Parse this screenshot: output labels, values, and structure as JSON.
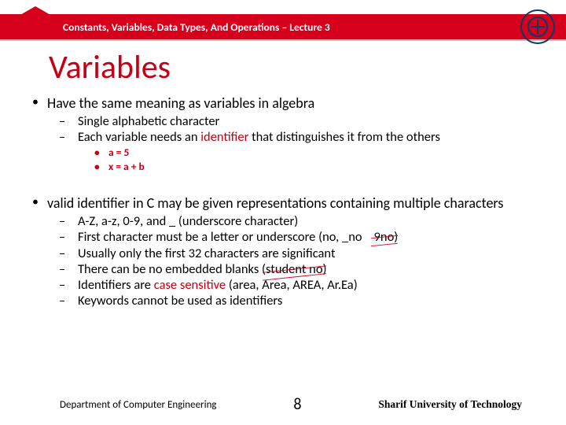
{
  "header": {
    "course_line": "Constants, Variables, Data Types, And Operations – Lecture 3"
  },
  "title": "Variables",
  "main": {
    "point1": {
      "text": "Have the same meaning as variables in algebra",
      "sub": [
        "Single alphabetic character",
        {
          "pre": "Each variable needs an ",
          "hi": "identifier",
          "post": " that distinguishes it from the others"
        }
      ],
      "code": [
        "a = 5",
        "x = a + b"
      ]
    },
    "point2": {
      "text": "valid identifier in C may be given representations containing multiple characters",
      "sub": [
        "A-Z, a-z, 0-9, and _ (underscore character)",
        {
          "pre": "First character must be a letter or underscore (no, _no",
          "strike": "9no",
          "post": ")"
        },
        "Usually only the first 32 characters are significant",
        {
          "pre": "There can be no embedded blanks (",
          "strike": "student no",
          "post": ")"
        },
        {
          "pre": "Identifiers are ",
          "hi": "case sensitive",
          "post": " (area, Area, AREA, Ar.Ea)"
        },
        "Keywords cannot be used as identifiers"
      ]
    }
  },
  "footer": {
    "dept": "Department of Computer Engineering",
    "page": "8",
    "univ": "Sharif University of Technology"
  }
}
